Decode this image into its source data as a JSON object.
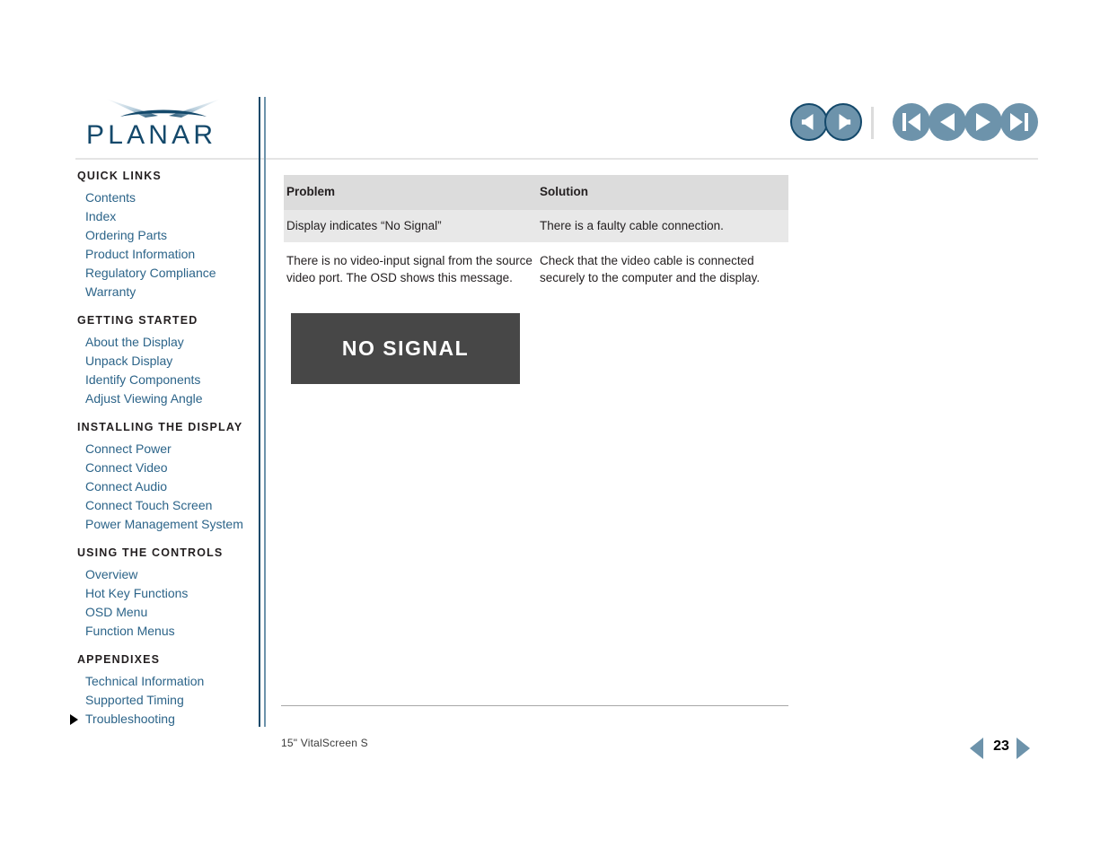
{
  "brand": {
    "logo_text": "PLANAR",
    "logo_mark": "planar-swoosh-icon"
  },
  "topnav": {
    "buttons": [
      {
        "name": "back-button",
        "icon": "arrow-left-icon",
        "style": "outlined"
      },
      {
        "name": "forward-button",
        "icon": "arrow-right-icon",
        "style": "outlined"
      },
      {
        "name": "first-page-button",
        "icon": "skip-to-start-icon",
        "style": "plain"
      },
      {
        "name": "previous-page-button",
        "icon": "previous-icon",
        "style": "plain"
      },
      {
        "name": "next-page-button",
        "icon": "next-icon",
        "style": "plain"
      },
      {
        "name": "last-page-button",
        "icon": "skip-to-end-icon",
        "style": "plain"
      }
    ]
  },
  "sidebar": {
    "sections": [
      {
        "heading": "QUICK LINKS",
        "links": [
          {
            "label": "Contents",
            "current": false
          },
          {
            "label": "Index",
            "current": false
          },
          {
            "label": "Ordering Parts",
            "current": false
          },
          {
            "label": "Product Information",
            "current": false
          },
          {
            "label": "Regulatory Compliance",
            "current": false
          },
          {
            "label": "Warranty",
            "current": false
          }
        ]
      },
      {
        "heading": "GETTING STARTED",
        "links": [
          {
            "label": "About the Display",
            "current": false
          },
          {
            "label": "Unpack Display",
            "current": false
          },
          {
            "label": "Identify Components",
            "current": false
          },
          {
            "label": "Adjust Viewing Angle",
            "current": false
          }
        ]
      },
      {
        "heading": "INSTALLING THE DISPLAY",
        "links": [
          {
            "label": "Connect Power",
            "current": false
          },
          {
            "label": "Connect Video",
            "current": false
          },
          {
            "label": "Connect Audio",
            "current": false
          },
          {
            "label": "Connect Touch Screen",
            "current": false
          },
          {
            "label": "Power Management System",
            "current": false
          }
        ]
      },
      {
        "heading": "USING THE CONTROLS",
        "links": [
          {
            "label": "Overview",
            "current": false
          },
          {
            "label": "Hot Key Functions",
            "current": false
          },
          {
            "label": "OSD Menu",
            "current": false
          },
          {
            "label": "Function Menus",
            "current": false
          }
        ]
      },
      {
        "heading": "APPENDIXES",
        "links": [
          {
            "label": "Technical Information",
            "current": false
          },
          {
            "label": "Supported Timing",
            "current": false
          },
          {
            "label": "Troubleshooting",
            "current": true
          }
        ]
      }
    ]
  },
  "main": {
    "table": {
      "headers": [
        "Problem",
        "Solution"
      ],
      "rows": [
        {
          "shaded": true,
          "cells": [
            "Display indicates “No Signal”",
            "There is a faulty cable connection."
          ]
        },
        {
          "shaded": false,
          "cells": [
            "There is no video-input signal from the source video port.  The OSD shows this message.",
            "Check that the video cable is connected securely to the computer and the display."
          ]
        }
      ]
    },
    "osd_image": {
      "text": "NO SIGNAL",
      "background_color": "#474747",
      "text_color": "#ffffff"
    }
  },
  "footer": {
    "product_label": "15\" VitalScreen S",
    "page_number": "23"
  },
  "colors": {
    "brand_navy": "#14496b",
    "link_blue": "#2c6489",
    "steel_blue": "#6d93ab",
    "table_header_bg": "#dcdcdc",
    "table_row_bg": "#e8e8e8"
  }
}
